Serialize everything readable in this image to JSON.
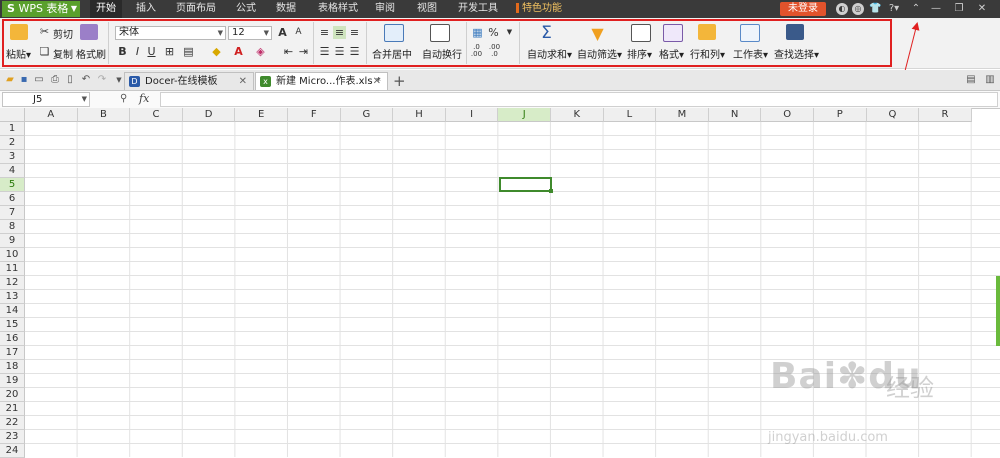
{
  "app": {
    "name": "WPS 表格"
  },
  "menu": {
    "tabs": [
      "开始",
      "插入",
      "页面布局",
      "公式",
      "数据",
      "表格样式",
      "审阅",
      "视图",
      "开发工具"
    ],
    "special": "特色功能",
    "login": "未登录",
    "help": "?"
  },
  "ribbon": {
    "paste": "粘贴",
    "cut": "剪切",
    "copy": "复制",
    "format_painter": "格式刷",
    "font_name": "宋体",
    "font_size": "12",
    "bold": "B",
    "italic": "I",
    "underline": "U",
    "merge_center": "合并居中",
    "wrap_text": "自动换行",
    "percent": "%",
    "autosum": "自动求和",
    "autofilter": "自动筛选",
    "sort": "排序",
    "format": "格式",
    "rows_cols": "行和列",
    "worksheet": "工作表",
    "find_select": "查找选择",
    "grow_font": "A",
    "shrink_font": "A",
    "font_color": "A",
    "dec_inc": ".0\n.00",
    "dec_dec": ".00\n.0"
  },
  "tabs": [
    {
      "label": "Docer-在线模板"
    },
    {
      "label": "新建 Micro...作表.xls *"
    }
  ],
  "formula_bar": {
    "cell_ref": "J5",
    "fx": "fx",
    "value": ""
  },
  "sheet": {
    "columns": [
      "A",
      "B",
      "C",
      "D",
      "E",
      "F",
      "G",
      "H",
      "I",
      "J",
      "K",
      "L",
      "M",
      "N",
      "O",
      "P",
      "Q",
      "R"
    ],
    "rows": [
      "1",
      "2",
      "3",
      "4",
      "5",
      "6",
      "7",
      "8",
      "9",
      "10",
      "11",
      "12",
      "13",
      "14",
      "15",
      "16",
      "17",
      "18",
      "19",
      "20",
      "21",
      "22",
      "23",
      "24"
    ],
    "selected_column": "J",
    "selected_row": "5"
  },
  "watermark": {
    "main": "Bai",
    "brand": "du",
    "cn": "经验",
    "sub": "jingyan.baidu.com"
  },
  "colors": {
    "accent": "#5aa02c",
    "highlight": "#e02020",
    "selection": "#3f8a2c",
    "login": "#e2532c"
  }
}
